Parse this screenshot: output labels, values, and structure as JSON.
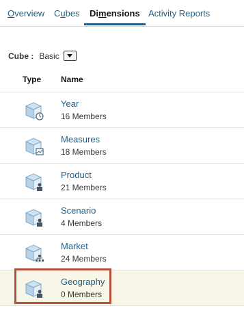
{
  "tabs": [
    {
      "label": "Overview",
      "underline": "O"
    },
    {
      "label": "Cubes",
      "underline": "u"
    },
    {
      "label": "Dimensions",
      "underline": "m"
    },
    {
      "label": "Activity Reports",
      "underline": ""
    }
  ],
  "cube": {
    "label": "Cube :",
    "value": "Basic"
  },
  "table": {
    "headers": {
      "type": "Type",
      "name": "Name"
    },
    "rows": [
      {
        "name": "Year",
        "members": "16 Members",
        "icon": "time-dimension-icon"
      },
      {
        "name": "Measures",
        "members": "18 Members",
        "icon": "accounts-dimension-icon"
      },
      {
        "name": "Product",
        "members": "21 Members",
        "icon": "regular-dimension-icon"
      },
      {
        "name": "Scenario",
        "members": "4 Members",
        "icon": "regular-dimension-icon"
      },
      {
        "name": "Market",
        "members": "24 Members",
        "icon": "hierarchy-dimension-icon"
      },
      {
        "name": "Geography",
        "members": "0 Members",
        "icon": "regular-dimension-icon"
      }
    ]
  },
  "colors": {
    "accent": "#1f5f8a",
    "highlight": "#b4513c",
    "selected_row": "#f8f6e6"
  }
}
